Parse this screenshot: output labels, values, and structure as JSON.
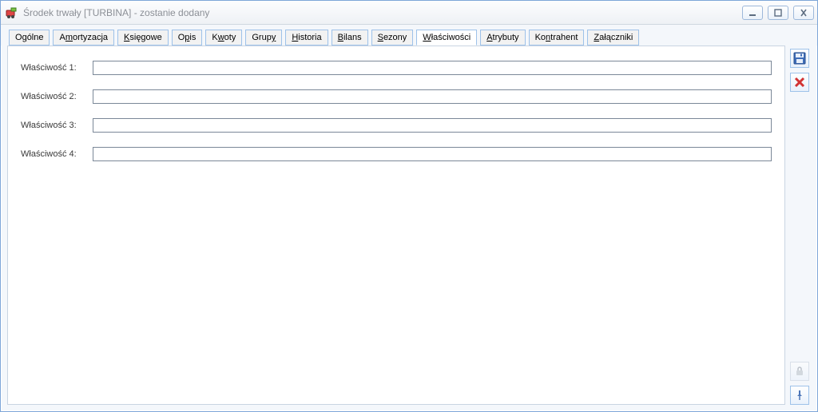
{
  "window": {
    "title": "Środek trwały [TURBINA] - zostanie dodany"
  },
  "tabs": [
    {
      "pre": "O",
      "u": "g",
      "post": "ólne"
    },
    {
      "pre": "A",
      "u": "m",
      "post": "ortyzacja"
    },
    {
      "pre": "",
      "u": "K",
      "post": "sięgowe"
    },
    {
      "pre": "O",
      "u": "p",
      "post": "is"
    },
    {
      "pre": "K",
      "u": "w",
      "post": "oty"
    },
    {
      "pre": "Grup",
      "u": "y",
      "post": ""
    },
    {
      "pre": "",
      "u": "H",
      "post": "istoria"
    },
    {
      "pre": "",
      "u": "B",
      "post": "ilans"
    },
    {
      "pre": "",
      "u": "S",
      "post": "ezony"
    },
    {
      "pre": "",
      "u": "W",
      "post": "łaściwości",
      "active": true
    },
    {
      "pre": "",
      "u": "A",
      "post": "trybuty"
    },
    {
      "pre": "Ko",
      "u": "n",
      "post": "trahent"
    },
    {
      "pre": "",
      "u": "Z",
      "post": "ałączniki"
    }
  ],
  "form": {
    "fields": [
      {
        "label": "Właściwość 1:",
        "value": ""
      },
      {
        "label": "Właściwość 2:",
        "value": ""
      },
      {
        "label": "Właściwość 3:",
        "value": ""
      },
      {
        "label": "Właściwość 4:",
        "value": ""
      }
    ]
  },
  "sidebar": {
    "save_enabled": true,
    "delete_enabled": true,
    "lock_enabled": false,
    "pin_enabled": true
  },
  "icons": {
    "minimize": "minimize",
    "maximize": "maximize",
    "close": "close"
  }
}
